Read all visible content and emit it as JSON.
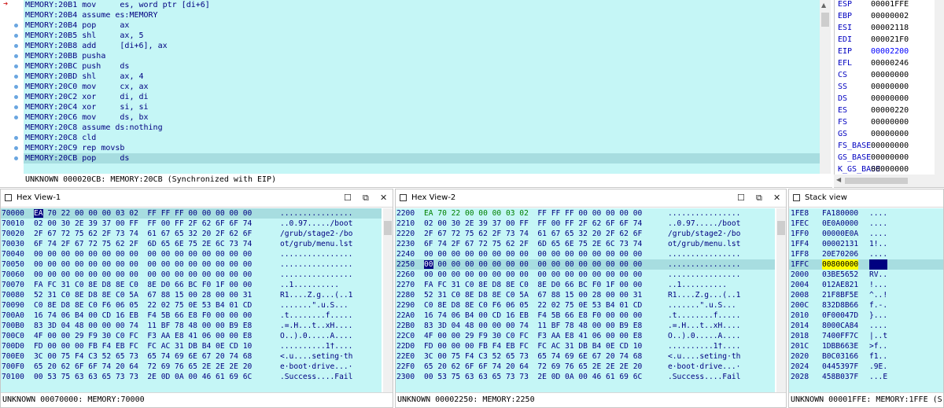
{
  "disasm": {
    "lines": [
      {
        "text": "MEMORY:20B1 mov     es, word ptr [di+6]",
        "mark": "arrow",
        "sel": false
      },
      {
        "text": "MEMORY:20B4 assume es:MEMORY",
        "mark": "",
        "sel": false
      },
      {
        "text": "MEMORY:20B4 pop     ax",
        "mark": "dot",
        "sel": false
      },
      {
        "text": "MEMORY:20B5 shl     ax, 5",
        "mark": "dot",
        "sel": false
      },
      {
        "text": "MEMORY:20B8 add     [di+6], ax",
        "mark": "dot",
        "sel": false
      },
      {
        "text": "MEMORY:20BB pusha",
        "mark": "dot",
        "sel": false
      },
      {
        "text": "MEMORY:20BC push    ds",
        "mark": "dot",
        "sel": false
      },
      {
        "text": "MEMORY:20BD shl     ax, 4",
        "mark": "dot",
        "sel": false
      },
      {
        "text": "MEMORY:20C0 mov     cx, ax",
        "mark": "dot",
        "sel": false
      },
      {
        "text": "MEMORY:20C2 xor     di, di",
        "mark": "dot",
        "sel": false
      },
      {
        "text": "MEMORY:20C4 xor     si, si",
        "mark": "dot",
        "sel": false
      },
      {
        "text": "MEMORY:20C6 mov     ds, bx",
        "mark": "dot",
        "sel": false
      },
      {
        "text": "MEMORY:20C8 assume ds:nothing",
        "mark": "",
        "sel": false
      },
      {
        "text": "MEMORY:20C8 cld",
        "mark": "dot",
        "sel": false
      },
      {
        "text": "MEMORY:20C9 rep movsb",
        "mark": "dot",
        "sel": false
      },
      {
        "text": "MEMORY:20CB pop     ds",
        "mark": "dot",
        "sel": true
      }
    ],
    "status": "UNKNOWN 000020CB: MEMORY:20CB (Synchronized with EIP)"
  },
  "registers": [
    {
      "name": "ESP",
      "value": "00001FFE",
      "changed": false
    },
    {
      "name": "EBP",
      "value": "00000002",
      "changed": false
    },
    {
      "name": "ESI",
      "value": "00002118",
      "changed": false
    },
    {
      "name": "EDI",
      "value": "000021F0",
      "changed": false
    },
    {
      "name": "EIP",
      "value": "00002200",
      "changed": true
    },
    {
      "name": "EFL",
      "value": "00000246",
      "changed": false
    },
    {
      "name": "CS",
      "value": "00000000",
      "changed": false
    },
    {
      "name": "SS",
      "value": "00000000",
      "changed": false
    },
    {
      "name": "DS",
      "value": "00000000",
      "changed": false
    },
    {
      "name": "ES",
      "value": "00000220",
      "changed": false
    },
    {
      "name": "FS",
      "value": "00000000",
      "changed": false
    },
    {
      "name": "GS",
      "value": "00000000",
      "changed": false
    },
    {
      "name": "FS_BASE",
      "value": "00000000",
      "changed": false
    },
    {
      "name": "GS_BASE",
      "value": "00000000",
      "changed": false
    },
    {
      "name": "K_GS_BASE",
      "value": "00000000",
      "changed": false
    },
    {
      "name": "CR0",
      "value": "00000010",
      "changed": false
    }
  ],
  "hex1": {
    "title": "Hex View-1",
    "status": "UNKNOWN 00070000: MEMORY:70000",
    "rows": [
      {
        "addr": "70000",
        "bytes": "EA 70 22 00 00 00 03 02  FF FF FF 00 00 00 00 00",
        "ascii": "................"
      },
      {
        "addr": "70010",
        "bytes": "02 00 30 2E 39 37 00 FF  FF 00 FF 2F 62 6F 6F 74",
        "ascii": "..0.97...../boot"
      },
      {
        "addr": "70020",
        "bytes": "2F 67 72 75 62 2F 73 74  61 67 65 32 20 2F 62 6F",
        "ascii": "/grub/stage2·/bo"
      },
      {
        "addr": "70030",
        "bytes": "6F 74 2F 67 72 75 62 2F  6D 65 6E 75 2E 6C 73 74",
        "ascii": "ot/grub/menu.lst"
      },
      {
        "addr": "70040",
        "bytes": "00 00 00 00 00 00 00 00  00 00 00 00 00 00 00 00",
        "ascii": "................"
      },
      {
        "addr": "70050",
        "bytes": "00 00 00 00 00 00 00 00  00 00 00 00 00 00 00 00",
        "ascii": "................"
      },
      {
        "addr": "70060",
        "bytes": "00 00 00 00 00 00 00 00  00 00 00 00 00 00 00 00",
        "ascii": "................"
      },
      {
        "addr": "70070",
        "bytes": "FA FC 31 C0 8E D8 8E C0  8E D0 66 BC F0 1F 00 00",
        "ascii": "..1.­.­.­.......",
        "_n": 0
      },
      {
        "addr": "70080",
        "bytes": "52 31 C0 8E D8 8E C0 5A  67 88 15 00 28 00 00 31",
        "ascii": "R1..­..Z.g...(..1"
      },
      {
        "addr": "70090",
        "bytes": "C0 8E D8 8E C0 F6 06 05  22 02 75 0E 53 B4 01 CD",
        "ascii": "..­.....\".u.S..."
      },
      {
        "addr": "700A0",
        "bytes": "16 74 06 B4 00 CD 16 EB  F4 5B 66 E8 F0 00 00 00",
        "ascii": ".t........f....."
      },
      {
        "addr": "700B0",
        "bytes": "83 3D 04 48 00 00 00 74  11 BF 78 48 00 00 B9 E8",
        "ascii": ".=.H...t..xH...."
      },
      {
        "addr": "700C0",
        "bytes": "4F 00 00 29 F9 30 C0 FC  F3 AA E8 41 06 00 00 E8",
        "ascii": "O..).0.....A...."
      },
      {
        "addr": "700D0",
        "bytes": "FD 00 00 00 FB F4 EB FC  FC AC 31 DB B4 0E CD 10",
        "ascii": "..........1†...."
      },
      {
        "addr": "700E0",
        "bytes": "3C 00 75 F4 C3 52 65 73  65 74 69 6E 67 20 74 68",
        "ascii": "<.u....seting·th"
      },
      {
        "addr": "700F0",
        "bytes": "65 20 62 6F 6F 74 20 64  72 69 76 65 2E 2E 2E 20",
        "ascii": "e·boot·drive...·"
      },
      {
        "addr": "70100",
        "bytes": "00 53 75 63 63 65 73 73  2E 0D 0A 00 46 61 69 6C",
        "ascii": ".Success....Fail"
      }
    ]
  },
  "hex2": {
    "title": "Hex View-2",
    "status": "UNKNOWN 00002250: MEMORY:2250",
    "rows": [
      {
        "addr": "2200",
        "bytes": "EA 70 22 00 00 00 03 02  FF FF FF 00 00 00 00 00",
        "ascii": "................"
      },
      {
        "addr": "2210",
        "bytes": "02 00 30 2E 39 37 00 FF  FF 00 FF 2F 62 6F 6F 74",
        "ascii": "..0.97...../boot"
      },
      {
        "addr": "2220",
        "bytes": "2F 67 72 75 62 2F 73 74  61 67 65 32 20 2F 62 6F",
        "ascii": "/grub/stage2·/bo"
      },
      {
        "addr": "2230",
        "bytes": "6F 74 2F 67 72 75 62 2F  6D 65 6E 75 2E 6C 73 74",
        "ascii": "ot/grub/menu.lst"
      },
      {
        "addr": "2240",
        "bytes": "00 00 00 00 00 00 00 00  00 00 00 00 00 00 00 00",
        "ascii": "................"
      },
      {
        "addr": "2250",
        "bytes": "00 00 00 00 00 00 00 00  00 00 00 00 00 00 00 00",
        "ascii": "................"
      },
      {
        "addr": "2260",
        "bytes": "00 00 00 00 00 00 00 00  00 00 00 00 00 00 00 00",
        "ascii": "................"
      },
      {
        "addr": "2270",
        "bytes": "FA FC 31 C0 8E D8 8E C0  8E D0 66 BC F0 1F 00 00",
        "ascii": "..1.­.­.­......."
      },
      {
        "addr": "2280",
        "bytes": "52 31 C0 8E D8 8E C0 5A  67 88 15 00 28 00 00 31",
        "ascii": "R1..­..Z.g...(..1"
      },
      {
        "addr": "2290",
        "bytes": "C0 8E D8 8E C0 F6 06 05  22 02 75 0E 53 B4 01 CD",
        "ascii": "..­.....\".u.S..."
      },
      {
        "addr": "22A0",
        "bytes": "16 74 06 B4 00 CD 16 EB  F4 5B 66 E8 F0 00 00 00",
        "ascii": ".t........f....."
      },
      {
        "addr": "22B0",
        "bytes": "83 3D 04 48 00 00 00 74  11 BF 78 48 00 00 B9 E8",
        "ascii": ".=.H...t..xH...."
      },
      {
        "addr": "22C0",
        "bytes": "4F 00 00 29 F9 30 C0 FC  F3 AA E8 41 06 00 00 E8",
        "ascii": "O..).0.....A...."
      },
      {
        "addr": "22D0",
        "bytes": "FD 00 00 00 FB F4 EB FC  FC AC 31 DB B4 0E CD 10",
        "ascii": "..........1†...."
      },
      {
        "addr": "22E0",
        "bytes": "3C 00 75 F4 C3 52 65 73  65 74 69 6E 67 20 74 68",
        "ascii": "<.u....seting·th"
      },
      {
        "addr": "22F0",
        "bytes": "65 20 62 6F 6F 74 20 64  72 69 76 65 2E 2E 2E 20",
        "ascii": "e·boot·drive...·"
      },
      {
        "addr": "2300",
        "bytes": "00 53 75 63 63 65 73 73  2E 0D 0A 00 46 61 69 6C",
        "ascii": ".Success....Fail"
      }
    ]
  },
  "stack": {
    "title": "Stack view",
    "status": "UNKNOWN 00001FFE: MEMORY:1FFE (S",
    "rows": [
      {
        "addr": "1FE8",
        "value": "FA180000",
        "ascii": "...."
      },
      {
        "addr": "1FEC",
        "value": "0E0A0000",
        "ascii": "...."
      },
      {
        "addr": "1FF0",
        "value": "00000E0A",
        "ascii": "...."
      },
      {
        "addr": "1FF4",
        "value": "00002131",
        "ascii": "1!.."
      },
      {
        "addr": "1FF8",
        "value": "20E70206",
        "ascii": "...."
      },
      {
        "addr": "1FFC",
        "value": "00800000",
        "ascii": "...."
      },
      {
        "addr": "2000",
        "value": "03BE5652",
        "ascii": "RV.."
      },
      {
        "addr": "2004",
        "value": "012AE821",
        "ascii": "!..."
      },
      {
        "addr": "2008",
        "value": "21F8BF5E",
        "ascii": "^..!"
      },
      {
        "addr": "200C",
        "value": "832D8B66",
        "ascii": "f.-."
      },
      {
        "addr": "2010",
        "value": "0F00047D",
        "ascii": "}..."
      },
      {
        "addr": "2014",
        "value": "8000CA84",
        "ascii": "...."
      },
      {
        "addr": "2018",
        "value": "7400FF7C",
        "ascii": "|..t"
      },
      {
        "addr": "201C",
        "value": "1DBB663E",
        "ascii": ">f.."
      },
      {
        "addr": "2020",
        "value": "B0C03166",
        "ascii": "f1.."
      },
      {
        "addr": "2024",
        "value": "0445397F",
        "ascii": ".9E."
      },
      {
        "addr": "2028",
        "value": "458B037F",
        "ascii": "...E"
      }
    ]
  },
  "colors": {
    "pane_bg": "#c5f6f6",
    "current_line": "#a7dde0",
    "addr_blue": "#000080",
    "selection": "#000080"
  }
}
